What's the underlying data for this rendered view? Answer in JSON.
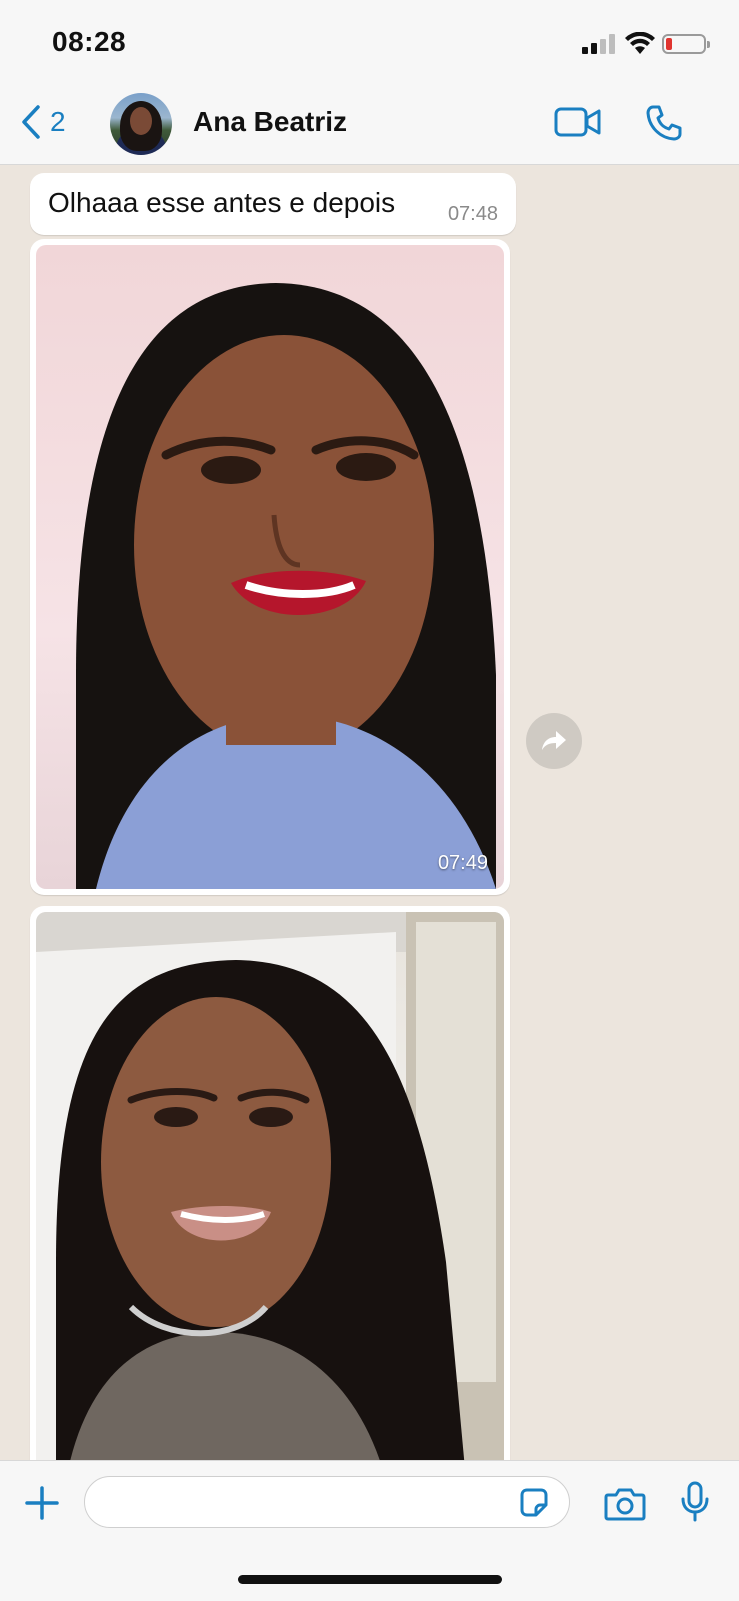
{
  "status_bar": {
    "time": "08:28"
  },
  "header": {
    "back_count": "2",
    "contact_name": "Ana Beatriz"
  },
  "messages": [
    {
      "type": "text",
      "text": "Olhaaa esse antes e depois",
      "time": "07:48"
    },
    {
      "type": "image",
      "time": "07:49"
    },
    {
      "type": "image"
    }
  ],
  "input": {
    "value": "",
    "placeholder": ""
  },
  "icons": {
    "back": "chevron-left-icon",
    "video": "video-camera-icon",
    "phone": "phone-icon",
    "forward": "forward-icon",
    "plus": "plus-icon",
    "sticker": "sticker-icon",
    "camera": "camera-icon",
    "mic": "microphone-icon"
  },
  "colors": {
    "accent": "#1a7fc1",
    "chat_bg": "#ece5dd",
    "bubble": "#ffffff",
    "battery_low": "#e0342f"
  }
}
